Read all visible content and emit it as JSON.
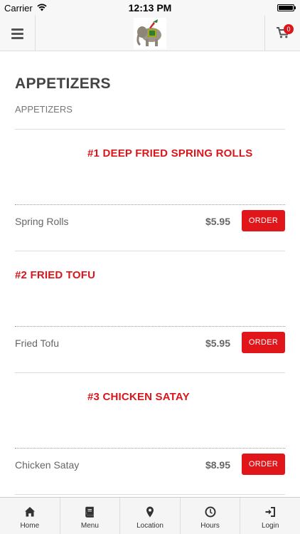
{
  "status_bar": {
    "carrier": "Carrier",
    "time": "12:13 PM"
  },
  "header": {
    "cart_count": "0"
  },
  "section": {
    "title": "APPETIZERS",
    "subtitle": "APPETIZERS"
  },
  "items": [
    {
      "name": "#1 DEEP FRIED SPRING ROLLS",
      "label": "Spring Rolls",
      "price": "$5.95",
      "button": "ORDER"
    },
    {
      "name": "#2 FRIED TOFU",
      "label": "Fried Tofu",
      "price": "$5.95",
      "button": "ORDER"
    },
    {
      "name": "#3 CHICKEN SATAY",
      "label": "Chicken Satay",
      "price": "$8.95",
      "button": "ORDER"
    }
  ],
  "nav": [
    {
      "label": "Home",
      "icon": "home-icon"
    },
    {
      "label": "Menu",
      "icon": "book-icon"
    },
    {
      "label": "Location",
      "icon": "map-pin-icon"
    },
    {
      "label": "Hours",
      "icon": "clock-icon"
    },
    {
      "label": "Login",
      "icon": "sign-in-icon"
    }
  ],
  "colors": {
    "accent": "#e0161b",
    "header_bg": "#f7f7f7"
  }
}
